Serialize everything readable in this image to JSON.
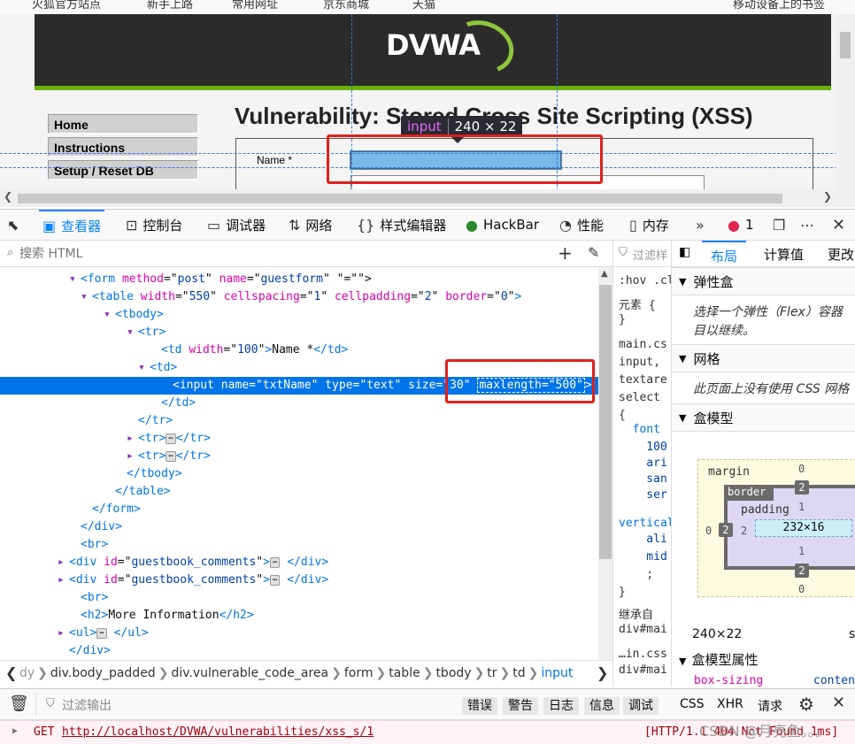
{
  "bookmarks": [
    "火狐官方站点",
    "新手上路",
    "常用网址",
    "京东商城",
    "天猫",
    "移动设备上的书签"
  ],
  "dvwa": {
    "logo": "DVWA",
    "menu": [
      "Home",
      "Instructions",
      "Setup / Reset DB"
    ],
    "page_title": "Vulnerability: Stored Cross Site Scripting (XSS)",
    "name_label": "Name *"
  },
  "tooltip": {
    "tag": "input",
    "size": "240 × 22"
  },
  "devtools": {
    "tabs": [
      "查看器",
      "控制台",
      "调试器",
      "网络",
      "样式编辑器",
      "HackBar",
      "性能",
      "内存"
    ],
    "error_count": "1",
    "search_placeholder": "搜索 HTML",
    "rules_filter": "过滤样",
    "layout_tabs": [
      "布局",
      "计算值",
      "更改"
    ],
    "markup": [
      {
        "indent": 7,
        "twisty": "▾",
        "html": "<span class='tg'>&lt;form</span> <span class='an'>method</span>=\"<span class='av'>post</span>\" <span class='an'>name</span>=\"<span class='av'>guestform</span>\" \"=\"\"&gt;"
      },
      {
        "indent": 8,
        "twisty": "▾",
        "html": "<span class='tg'>&lt;table</span> <span class='an'>width</span>=\"<span class='av'>550</span>\" <span class='an'>cellspacing</span>=\"<span class='av'>1</span>\" <span class='an'>cellpadding</span>=\"<span class='av'>2</span>\" <span class='an'>border</span>=\"<span class='av'>0</span>\"<span class='tg'>&gt;</span>"
      },
      {
        "indent": 10,
        "twisty": "▾",
        "html": "<span class='tg'>&lt;tbody&gt;</span>"
      },
      {
        "indent": 12,
        "twisty": "▾",
        "html": "<span class='tg'>&lt;tr&gt;</span>"
      },
      {
        "indent": 14,
        "twisty": "",
        "html": "<span class='tg'>&lt;td</span> <span class='an'>width</span>=\"<span class='av'>100</span>\"<span class='tg'>&gt;</span>Name *<span class='tg'>&lt;/td&gt;</span>"
      },
      {
        "indent": 13,
        "twisty": "▾",
        "html": "<span class='tg'>&lt;td&gt;</span>"
      },
      {
        "indent": 15,
        "twisty": "",
        "sel": true,
        "html": "<span class='tg'>&lt;input</span> <span class='an'>name</span>=\"<span class='av'>txtName</span>\" <span class='an'>type</span>=\"<span class='av'>text</span>\" <span class='an'>size</span>=\"<span class='av'>30</span>\" <span style='border:1px dashed #fff;padding:0 1px'><span class='an'>maxlength</span>=\"<span class='av'>500</span>\"</span><span class='tg'>&gt;</span>"
      },
      {
        "indent": 14,
        "twisty": "",
        "html": "<span class='tg'>&lt;/td&gt;</span>"
      },
      {
        "indent": 12,
        "twisty": "",
        "html": "<span class='tg'>&lt;/tr&gt;</span>"
      },
      {
        "indent": 12,
        "twisty": "▸",
        "html": "<span class='tg'>&lt;tr&gt;</span><span class='ell'>⋯</span><span class='tg'>&lt;/tr&gt;</span>"
      },
      {
        "indent": 12,
        "twisty": "▸",
        "html": "<span class='tg'>&lt;tr&gt;</span><span class='ell'>⋯</span><span class='tg'>&lt;/tr&gt;</span>"
      },
      {
        "indent": 11,
        "twisty": "",
        "html": "<span class='tg'>&lt;/tbody&gt;</span>"
      },
      {
        "indent": 10,
        "twisty": "",
        "html": "<span class='tg'>&lt;/table&gt;</span>"
      },
      {
        "indent": 8,
        "twisty": "",
        "html": "<span class='tg'>&lt;/form&gt;</span>"
      },
      {
        "indent": 7,
        "twisty": "",
        "html": "<span class='tg'>&lt;/div&gt;</span>"
      },
      {
        "indent": 7,
        "twisty": "",
        "html": "<span class='tg'>&lt;br&gt;</span>"
      },
      {
        "indent": 6,
        "twisty": "▸",
        "html": "<span class='tg'>&lt;div</span> <span class='an'>id</span>=\"<span class='av'>guestbook_comments</span>\"<span class='tg'>&gt;</span><span class='ell'>⋯</span> <span class='tg'>&lt;/div&gt;</span>"
      },
      {
        "indent": 6,
        "twisty": "▸",
        "html": "<span class='tg'>&lt;div</span> <span class='an'>id</span>=\"<span class='av'>guestbook_comments</span>\"<span class='tg'>&gt;</span><span class='ell'>⋯</span> <span class='tg'>&lt;/div&gt;</span>"
      },
      {
        "indent": 7,
        "twisty": "",
        "html": "<span class='tg'>&lt;br&gt;</span>"
      },
      {
        "indent": 7,
        "twisty": "",
        "html": "<span class='tg'>&lt;h2&gt;</span>More Information<span class='tg'>&lt;/h2&gt;</span>"
      },
      {
        "indent": 6,
        "twisty": "▸",
        "html": "<span class='tg'>&lt;ul&gt;</span><span class='ell'>⋯</span> <span class='tg'>&lt;/ul&gt;</span>"
      },
      {
        "indent": 6,
        "twisty": "",
        "html": "<span class='tg'>&lt;/div&gt;</span>"
      }
    ],
    "breadcrumbs": [
      "dy",
      "div.body_padded",
      "div.vulnerable_code_area",
      "form",
      "table",
      "tbody",
      "tr",
      "td",
      "input"
    ],
    "rules": [
      ":hov .cl",
      "元素 {",
      "}",
      "main.cs",
      "input,",
      "textare",
      "select",
      "{",
      "  font",
      "    100",
      "    ari",
      "    san",
      "    ser",
      "vertical",
      "    ali",
      "    mid",
      "    ;",
      "}",
      "继承自",
      "div#mai",
      "…in.css",
      "div#mai"
    ],
    "layout": {
      "flexbox": "弹性盒",
      "flexbox_desc": [
        "选择一个弹性（Flex）容器",
        "目以继续。"
      ],
      "grid": "网格",
      "grid_desc": "此页面上没有使用 CSS 网格",
      "boxmodel": "盒模型",
      "margin_label": "margin",
      "border_label": "border",
      "padding_label": "padding",
      "content": "232×16",
      "margin": {
        "top": "0",
        "bottom": "0",
        "left": "0"
      },
      "border": {
        "top": "2",
        "bottom": "2",
        "left": "2"
      },
      "padding": {
        "top": "1",
        "bottom": "1",
        "left": "2"
      },
      "dims": "240×22",
      "dims_right": "s",
      "props_title": "盒模型属性",
      "prop_name": "box-sizing",
      "prop_value": "conten"
    },
    "console": {
      "filter_placeholder": "过滤输出",
      "levels": [
        "错误",
        "警告",
        "日志",
        "信息",
        "调试"
      ],
      "types": [
        "CSS",
        "XHR",
        "请求"
      ],
      "log_method": "GET",
      "log_url": "http://localhost/DVWA/vulnerabilities/xss_s/1",
      "log_status": "[HTTP/1.1 404 Not Found 1ms]",
      "watermark": "CSDN @月亮鱼。。。"
    }
  }
}
